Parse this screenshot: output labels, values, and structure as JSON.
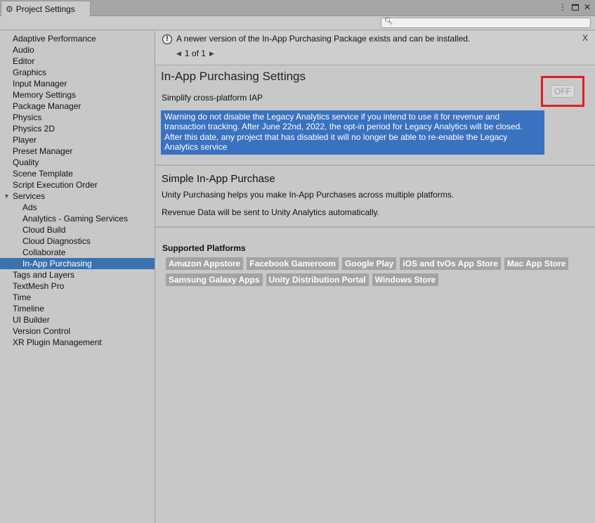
{
  "window": {
    "tab_title": "Project Settings",
    "icons": [
      "gear-icon",
      "kebab-menu-icon",
      "maximize-icon",
      "close-icon"
    ]
  },
  "search": {
    "placeholder": "",
    "icon": "search-icon"
  },
  "sidebar": {
    "items": [
      {
        "label": "Adaptive Performance"
      },
      {
        "label": "Audio"
      },
      {
        "label": "Editor"
      },
      {
        "label": "Graphics"
      },
      {
        "label": "Input Manager"
      },
      {
        "label": "Memory Settings"
      },
      {
        "label": "Package Manager"
      },
      {
        "label": "Physics"
      },
      {
        "label": "Physics 2D"
      },
      {
        "label": "Player"
      },
      {
        "label": "Preset Manager"
      },
      {
        "label": "Quality"
      },
      {
        "label": "Scene Template"
      },
      {
        "label": "Script Execution Order"
      },
      {
        "label": "Services"
      },
      {
        "label": "Ads"
      },
      {
        "label": "Analytics - Gaming Services"
      },
      {
        "label": "Cloud Build"
      },
      {
        "label": "Cloud Diagnostics"
      },
      {
        "label": "Collaborate"
      },
      {
        "label": "In-App Purchasing"
      },
      {
        "label": "Tags and Layers"
      },
      {
        "label": "TextMesh Pro"
      },
      {
        "label": "Time"
      },
      {
        "label": "Timeline"
      },
      {
        "label": "UI Builder"
      },
      {
        "label": "Version Control"
      },
      {
        "label": "XR Plugin Management"
      }
    ]
  },
  "notice": {
    "message": "A newer version of the In-App Purchasing Package exists and can be installed.",
    "pager": "1 of 1",
    "close": "X"
  },
  "iap": {
    "title": "In-App Purchasing Settings",
    "subtitle": "Simplify cross-platform IAP",
    "toggle_label": "OFF",
    "warning": "Warning do not disable the Legacy Analytics service if you intend to use it for revenue and transaction tracking. After June 22nd, 2022, the opt-in period for Legacy Analytics will be closed. After this date, any project that has disabled it will no longer be able to re-enable the Legacy Analytics service"
  },
  "simple": {
    "title": "Simple In-App Purchase",
    "line1": "Unity Purchasing helps you make In-App Purchases across multiple platforms.",
    "line2": "Revenue Data will be sent to Unity Analytics automatically."
  },
  "platforms": {
    "title": "Supported Platforms",
    "items": [
      "Amazon Appstore",
      "Facebook Gameroom",
      "Google Play",
      "iOS and tvOs App Store",
      "Mac App Store",
      "Samsung Galaxy Apps",
      "Unity Distribution Portal",
      "Windows Store"
    ]
  },
  "colors": {
    "selection": "#3a72b0",
    "warning_bg": "#3a72c0",
    "highlight_frame": "#e31b24",
    "chip_bg": "#a3a3a3"
  }
}
